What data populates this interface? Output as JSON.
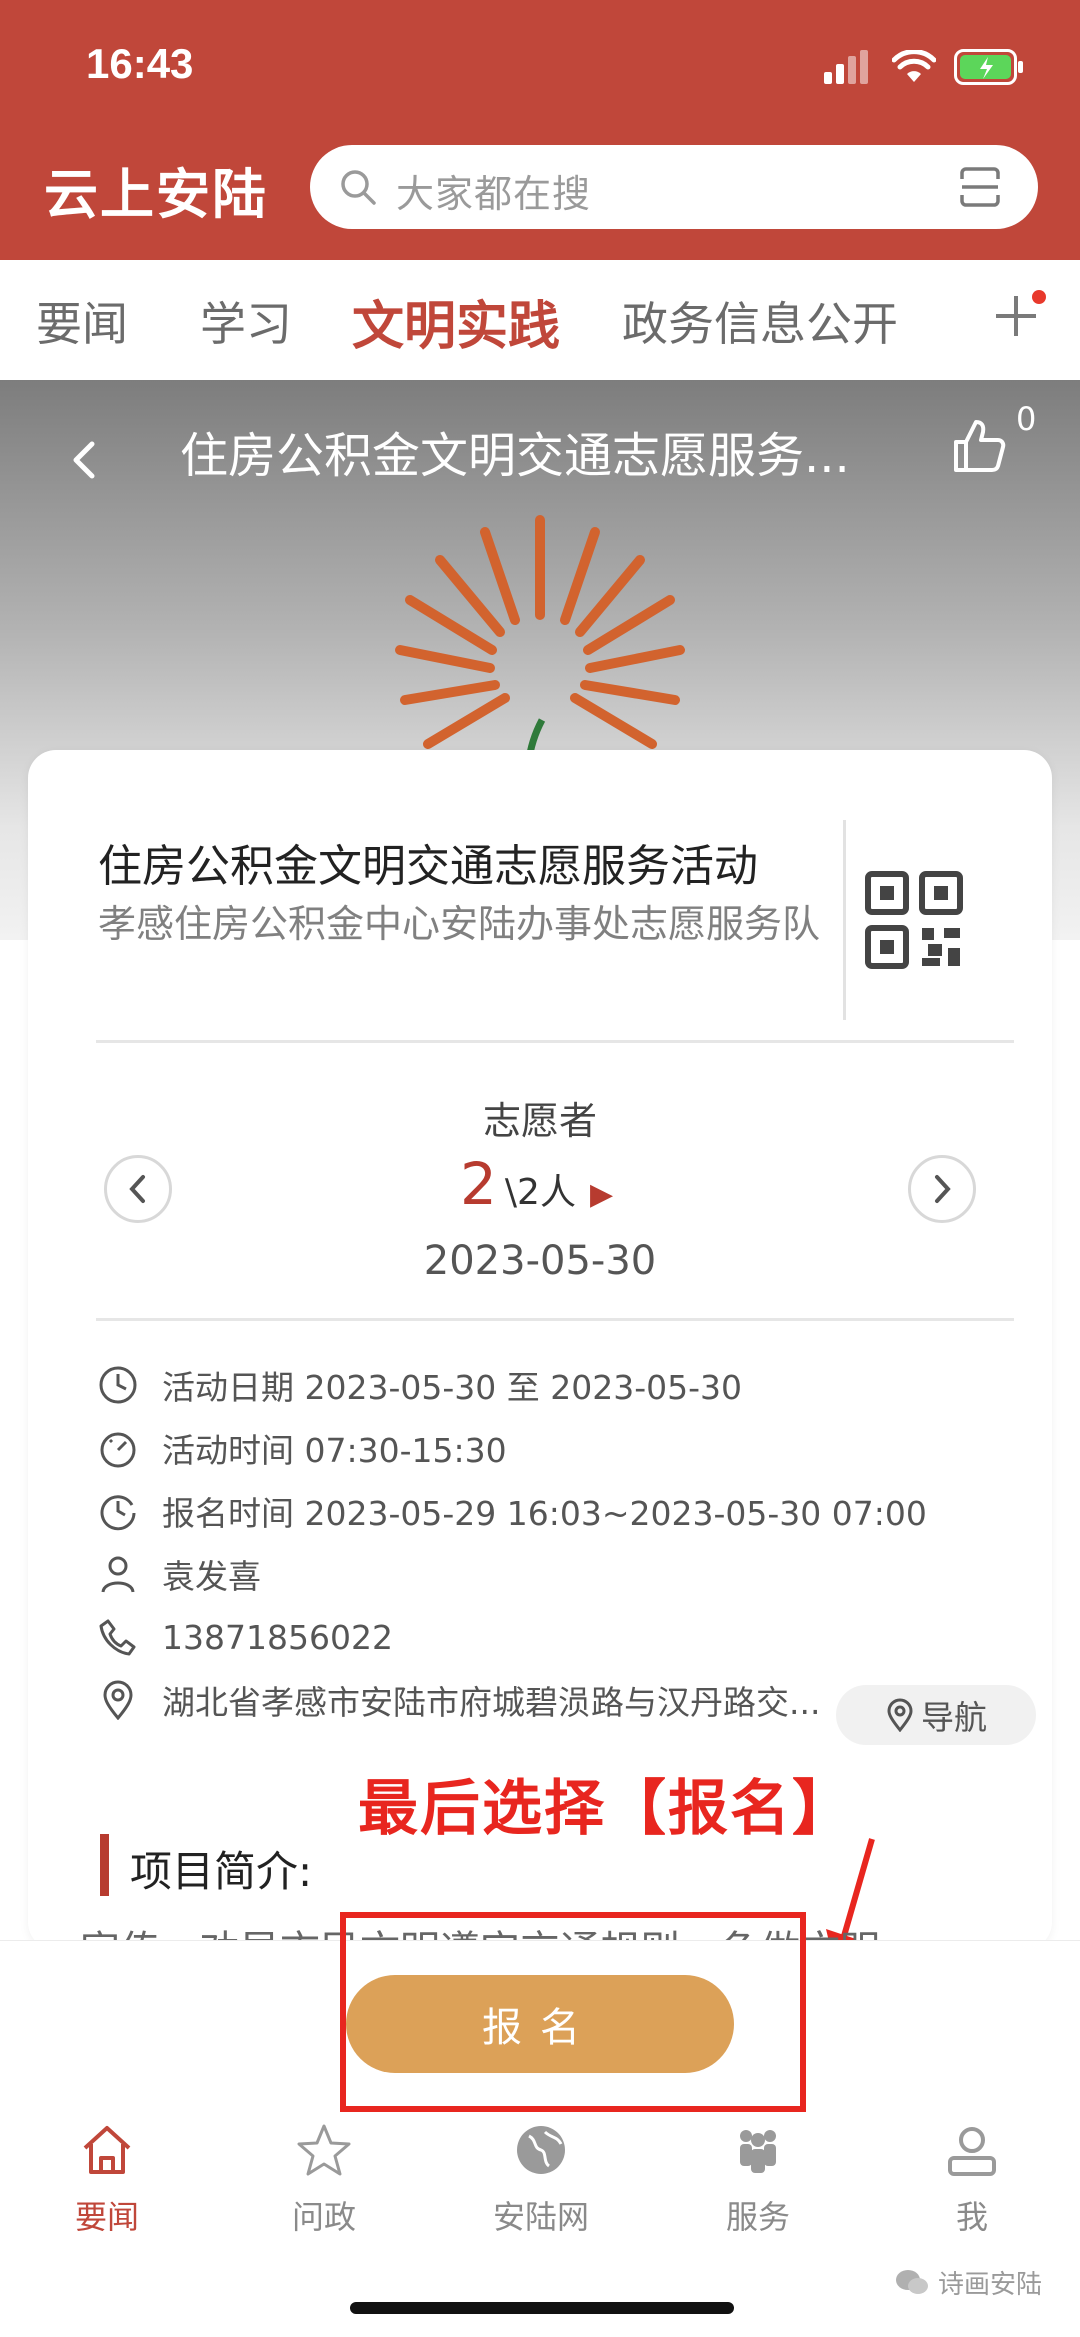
{
  "status_bar": {
    "time": "16:43"
  },
  "header": {
    "app_title": "云上安陆",
    "search_placeholder": "大家都在搜"
  },
  "tabs": [
    {
      "label": "要闻"
    },
    {
      "label": "学习"
    },
    {
      "label": "文明实践",
      "active": true
    },
    {
      "label": "政务信息公开"
    }
  ],
  "hero": {
    "title": "住房公积金文明交通志愿服务...",
    "like_count": "0"
  },
  "activity": {
    "title": "住房公积金文明交通志愿服务活动",
    "organizer": "孝感住房公积金中心安陆办事处志愿服务队"
  },
  "volunteers": {
    "label": "志愿者",
    "count": "2",
    "total": "\\2人",
    "date": "2023-05-30"
  },
  "details": {
    "activity_date": "活动日期 2023-05-30 至 2023-05-30",
    "activity_time": "活动时间 07:30-15:30",
    "signup_time": "报名时间 2023-05-29 16:03~2023-05-30 07:00",
    "contact": "袁发喜",
    "phone": "13871856022",
    "address": "湖北省孝感市安陆市府城碧涢路与汉丹路交...",
    "navigate_label": "导航"
  },
  "annotation": {
    "text": "最后选择【报名】"
  },
  "section": {
    "title": "项目简介:",
    "preview": "宣传、劝导市民文明遵守交通规则，争做文明"
  },
  "signup_button": {
    "label": "报名"
  },
  "tabbar": [
    {
      "label": "要闻",
      "icon": "home-icon",
      "active": true
    },
    {
      "label": "问政",
      "icon": "star-icon"
    },
    {
      "label": "安陆网",
      "icon": "globe-icon"
    },
    {
      "label": "服务",
      "icon": "people-icon"
    },
    {
      "label": "我",
      "icon": "user-icon"
    }
  ],
  "watermark": {
    "text": "诗画安陆"
  },
  "colors": {
    "brand_red": "#c0473a",
    "signup_orange": "#dca158",
    "annotation_red": "#e8261f"
  }
}
